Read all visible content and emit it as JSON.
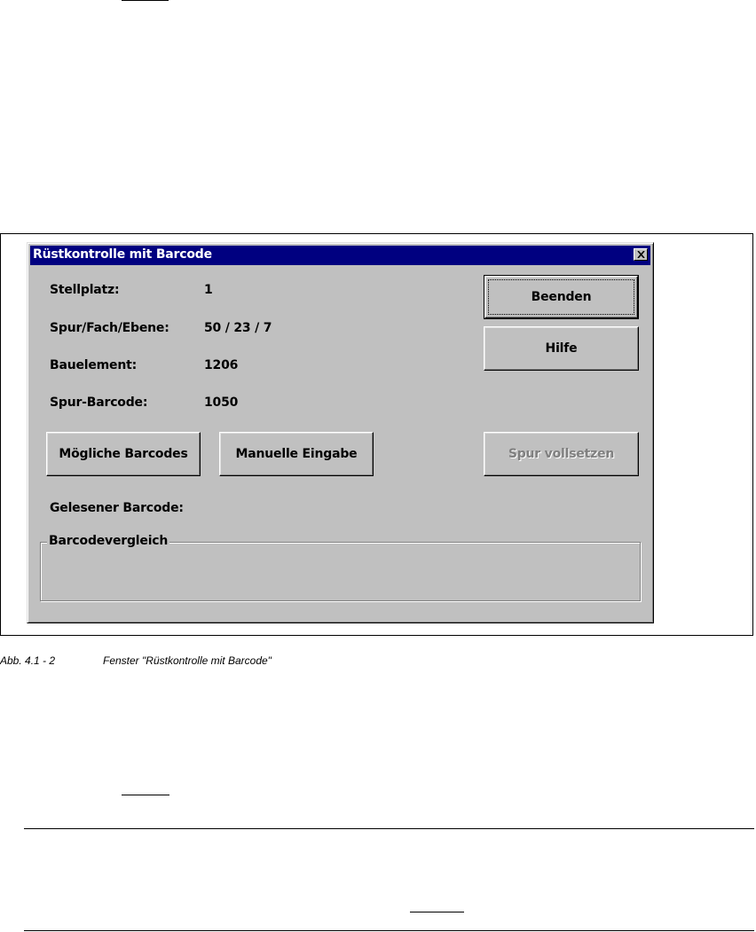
{
  "dialog": {
    "title": "Rüstkontrolle mit Barcode",
    "fields": [
      {
        "label": "Stellplatz:",
        "value": "1"
      },
      {
        "label": "Spur/Fach/Ebene:",
        "value": "50 / 23 / 7"
      },
      {
        "label": "Bauelement:",
        "value": "1206"
      },
      {
        "label": "Spur-Barcode:",
        "value": "1050"
      }
    ],
    "buttons": {
      "beenden": "Beenden",
      "hilfe": "Hilfe",
      "moegliche_barcodes": "Mögliche Barcodes",
      "manuelle_eingabe": "Manuelle Eingabe",
      "spur_vollsetzen": "Spur vollsetzen"
    },
    "gelesener_barcode_label": "Gelesener Barcode:",
    "group_title": "Barcodevergleich"
  },
  "caption": {
    "number": "Abb. 4.1 - 2",
    "text": "Fenster \"Rüstkontrolle mit Barcode\""
  }
}
